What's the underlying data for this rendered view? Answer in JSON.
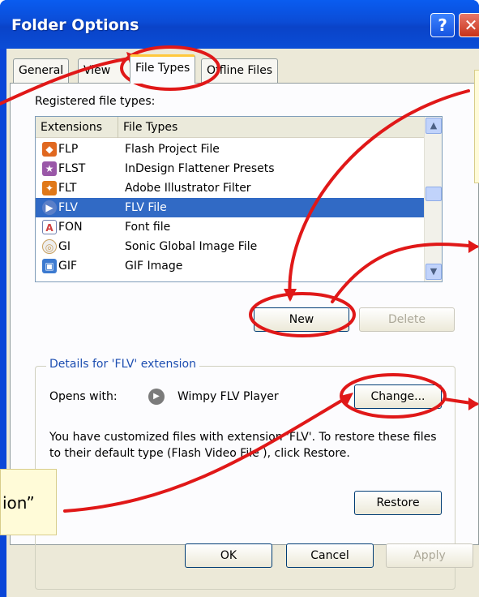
{
  "window": {
    "title": "Folder Options",
    "help_glyph": "?",
    "close_glyph": "✕"
  },
  "tabs": [
    {
      "label": "General",
      "active": false
    },
    {
      "label": "View",
      "active": false
    },
    {
      "label": "File Types",
      "active": true
    },
    {
      "label": "Offline Files",
      "active": false
    }
  ],
  "registered_label": "Registered file types:",
  "list": {
    "headers": {
      "extensions": "Extensions",
      "file_types": "File Types"
    },
    "rows": [
      {
        "ext": "FLP",
        "type": "Flash Project File",
        "icon": "flash-project-icon",
        "color": "#e06820"
      },
      {
        "ext": "FLST",
        "type": "InDesign Flattener Presets",
        "icon": "indesign-icon",
        "color": "#9a58a8"
      },
      {
        "ext": "FLT",
        "type": "Adobe Illustrator Filter",
        "icon": "illustrator-icon",
        "color": "#e07818"
      },
      {
        "ext": "FLV",
        "type": "FLV File",
        "icon": "play-icon",
        "color": "#5a7fc8",
        "selected": true
      },
      {
        "ext": "FON",
        "type": "Font file",
        "icon": "font-icon",
        "color": "#d04040"
      },
      {
        "ext": "GI",
        "type": "Sonic Global Image File",
        "icon": "disc-icon",
        "color": "#c8a060"
      },
      {
        "ext": "GIF",
        "type": "GIF Image",
        "icon": "gif-image-icon",
        "color": "#3c7ad0"
      }
    ]
  },
  "buttons": {
    "new": "New",
    "delete": "Delete",
    "change": "Change...",
    "restore": "Restore",
    "ok": "OK",
    "cancel": "Cancel",
    "apply": "Apply"
  },
  "details": {
    "title": "Details for 'FLV' extension",
    "opens_with_label": "Opens with:",
    "opens_with_app": "Wimpy FLV Player",
    "info_text": "You have customized files with extension 'FLV'.  To restore these files to their default type (Flash Video File ), click Restore."
  },
  "annotations": {
    "left_callout_text": "ion”",
    "stroke_color": "#e01818"
  }
}
